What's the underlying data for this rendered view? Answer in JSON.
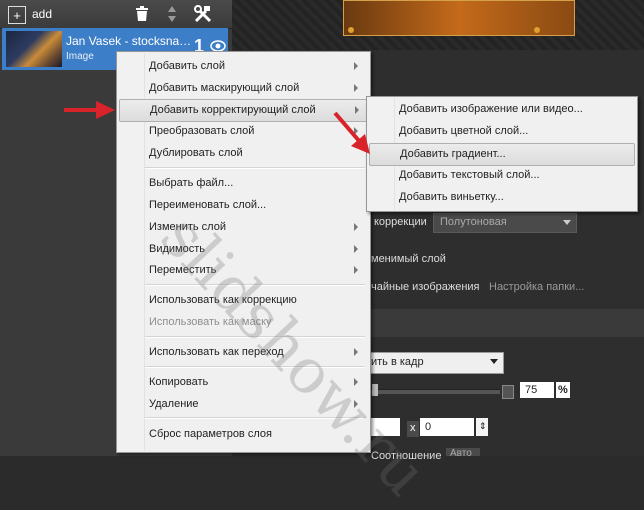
{
  "toolbar": {
    "add_label": "add",
    "icons": [
      "plus-icon",
      "trash-icon",
      "sort-arrows-icon",
      "tools-icon"
    ]
  },
  "layer": {
    "title": "Jan Vasek - stocksna…",
    "type": "Image",
    "number": "1"
  },
  "context_menu": {
    "items": [
      {
        "label": "Добавить слой",
        "submenu": true
      },
      {
        "label": "Добавить маскирующий слой",
        "submenu": true
      },
      {
        "label": "Добавить корректирующий слой",
        "submenu": true,
        "highlighted": true
      },
      {
        "label": "Преобразовать слой",
        "submenu": true
      },
      {
        "label": "Дублировать слой",
        "submenu": false
      },
      {
        "label": "Выбрать файл...",
        "submenu": false
      },
      {
        "label": "Переименовать слой...",
        "submenu": false
      },
      {
        "label": "Изменить слой",
        "submenu": true
      },
      {
        "label": "Видимость",
        "submenu": true
      },
      {
        "label": "Переместить",
        "submenu": true
      },
      {
        "label": "Использовать как коррекцию",
        "submenu": false
      },
      {
        "label": "Использовать как маску",
        "submenu": false,
        "disabled": true
      },
      {
        "label": "Использовать как переход",
        "submenu": true
      },
      {
        "label": "Копировать",
        "submenu": true
      },
      {
        "label": "Удаление",
        "submenu": true
      },
      {
        "label": "Сброс параметров слоя",
        "submenu": false
      }
    ]
  },
  "submenu": {
    "items": [
      {
        "label": "Добавить изображение или видео..."
      },
      {
        "label": "Добавить цветной слой..."
      },
      {
        "label": "Добавить градиент...",
        "highlighted": true
      },
      {
        "label": "Добавить текстовый слой..."
      },
      {
        "label": "Добавить виньетку..."
      }
    ]
  },
  "right_panel": {
    "correction_label": "коррекции",
    "correction_value": "Полутоновая",
    "checkbox1_label": "менимый слой",
    "checkbox2_label": "чайные изображения",
    "folder_settings_label": "Настройка папки...",
    "fit_value": "ить в кадр",
    "opacity_value": "75",
    "percent_symbol": "%",
    "coord_x_label": "x",
    "coord_value": "0",
    "ratio_label": "Соотношение",
    "ratio_value": "Авто"
  },
  "watermark": "slidshow.ru",
  "colors": {
    "selection": "#3d7ec8",
    "arrow": "#d9232a",
    "menu_bg": "#f0f0f0"
  }
}
